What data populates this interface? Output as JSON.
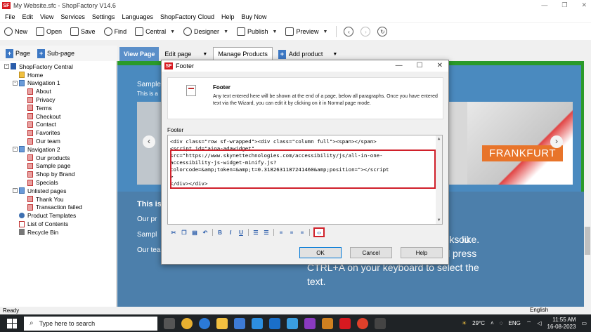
{
  "window": {
    "title": "My Website.sfc - ShopFactory V14.6",
    "logo": "SF"
  },
  "menu": [
    "File",
    "Edit",
    "View",
    "Services",
    "Settings",
    "Languages",
    "ShopFactory Cloud",
    "Help",
    "Buy Now"
  ],
  "toolbar": {
    "new": "New",
    "open": "Open",
    "save": "Save",
    "find": "Find",
    "central": "Central",
    "designer": "Designer",
    "publish": "Publish",
    "preview": "Preview"
  },
  "pagebar": {
    "page": "Page",
    "subpage": "Sub-page"
  },
  "tabs": {
    "view_page": "View Page",
    "edit_page": "Edit page",
    "manage_products": "Manage Products",
    "add_product": "Add product"
  },
  "tree": [
    {
      "label": "ShopFactory Central",
      "icon": "flag",
      "level": 0,
      "exp": "-"
    },
    {
      "label": "Home",
      "icon": "home",
      "level": 1,
      "exp": ""
    },
    {
      "label": "Navigation 1",
      "icon": "folder",
      "level": 1,
      "exp": "-"
    },
    {
      "label": "About",
      "icon": "pagered",
      "level": 2,
      "exp": ""
    },
    {
      "label": "Privacy",
      "icon": "pagered",
      "level": 2,
      "exp": ""
    },
    {
      "label": "Terms",
      "icon": "pagered",
      "level": 2,
      "exp": ""
    },
    {
      "label": "Checkout",
      "icon": "pagered",
      "level": 2,
      "exp": ""
    },
    {
      "label": "Contact",
      "icon": "pagered",
      "level": 2,
      "exp": ""
    },
    {
      "label": "Favorites",
      "icon": "pagered",
      "level": 2,
      "exp": ""
    },
    {
      "label": "Our team",
      "icon": "pagered",
      "level": 2,
      "exp": ""
    },
    {
      "label": "Navigation 2",
      "icon": "folder",
      "level": 1,
      "exp": "-"
    },
    {
      "label": "Our products",
      "icon": "pagered",
      "level": 2,
      "exp": ""
    },
    {
      "label": "Sample page",
      "icon": "pagered",
      "level": 2,
      "exp": ""
    },
    {
      "label": "Shop by Brand",
      "icon": "pagered",
      "level": 2,
      "exp": ""
    },
    {
      "label": "Specials",
      "icon": "pagered",
      "level": 2,
      "exp": ""
    },
    {
      "label": "Unlisted pages",
      "icon": "folder",
      "level": 1,
      "exp": "-"
    },
    {
      "label": "Thank You",
      "icon": "pagered",
      "level": 2,
      "exp": ""
    },
    {
      "label": "Transaction failed",
      "icon": "pagered",
      "level": 2,
      "exp": ""
    },
    {
      "label": "Product Templates",
      "icon": "gear",
      "level": 1,
      "exp": ""
    },
    {
      "label": "List of Contents",
      "icon": "page",
      "level": 1,
      "exp": ""
    },
    {
      "label": "Recycle Bin",
      "icon": "bin",
      "level": 1,
      "exp": ""
    }
  ],
  "content": {
    "sample_heading": "Sample",
    "sample_sub": "This is a",
    "banner_text": "FRANKFURT",
    "lower_title": "This is",
    "lower_l2": "Our pr",
    "lower_l3": "Sampl",
    "lower_l4": "Our tea",
    "lower_right_0": "ou",
    "lower_right": "can see what your new block looks like. To replace the text click on it and press CTRL+A on your keyboard to select the text."
  },
  "dialog": {
    "title": "Footer",
    "logo": "SF",
    "heading": "Footer",
    "description": "Any text entered here will be shown at the end of a page, below all paragraphs. Once you have entered text via the Wizard, you can edit it by clicking on it in Normal page mode.",
    "editor_label": "Footer",
    "code_lines": [
      "<div class=\"row sf-wrapped\"><div class=\"column full\"><span></span>",
      "",
      "<script id=\"aioa-adawidget\"",
      "src=\"https://www.skynettechnologies.com/accessibility/js/all-in-one-",
      "accessibility-js-widget-minify.js?",
      "colorcode=&amp;token=&amp;t=0.3182631187241460&amp;position=\"></script",
      ">",
      "",
      "</div></div>"
    ],
    "ok": "OK",
    "cancel": "Cancel",
    "help": "Help"
  },
  "status": {
    "left": "Ready",
    "lang": "English"
  },
  "taskbar": {
    "search_placeholder": "Type here to search",
    "temp": "29°C",
    "lang": "ENG",
    "time": "11:55 AM",
    "date": "16-08-2023"
  }
}
